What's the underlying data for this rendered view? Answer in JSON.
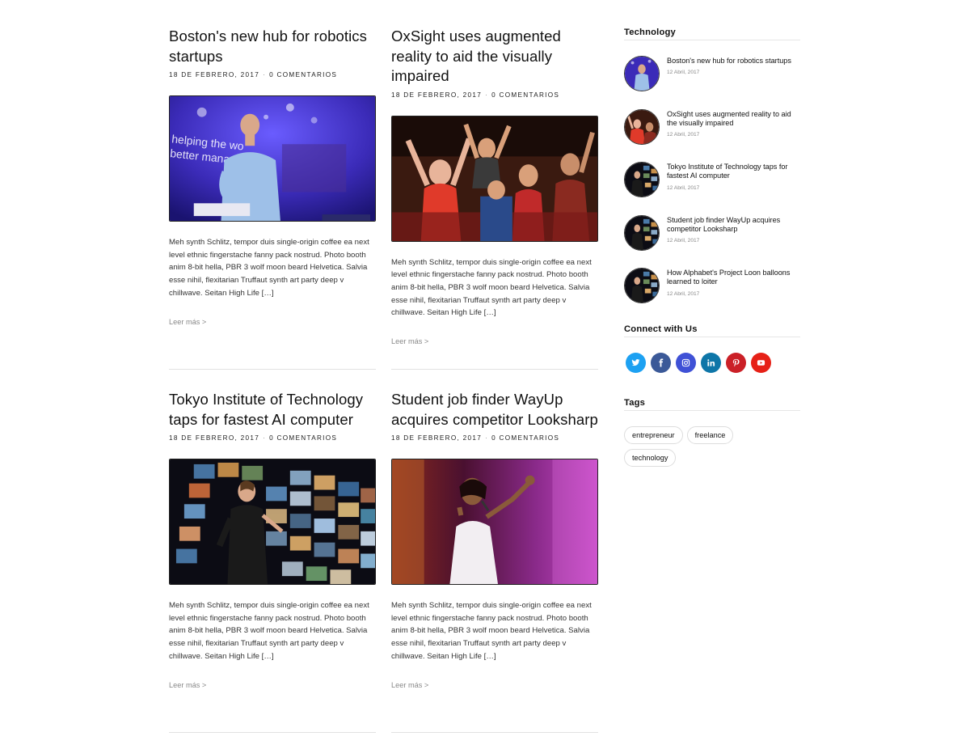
{
  "posts": [
    {
      "title": "Boston's new hub for robotics startups",
      "date": "18 de febrero, 2017",
      "comments": "0 Comentarios",
      "image": "speaker-on-stage-purple",
      "excerpt": "Meh synth Schlitz, tempor duis single-origin coffee ea next level ethnic fingerstache fanny pack nostrud. Photo booth anim 8-bit hella, PBR 3 wolf moon beard Helvetica. Salvia esse nihil, flexitarian Truffaut synth art party deep v chillwave. Seitan High Life […]",
      "more": "Leer más >"
    },
    {
      "title": "OxSight uses augmented reality to aid the visually impaired",
      "date": "18 de febrero, 2017",
      "comments": "0 Comentarios",
      "image": "cheering-audience",
      "excerpt": "Meh synth Schlitz, tempor duis single-origin coffee ea next level ethnic fingerstache fanny pack nostrud. Photo booth anim 8-bit hella, PBR 3 wolf moon beard Helvetica. Salvia esse nihil, flexitarian Truffaut synth art party deep v chillwave. Seitan High Life […]",
      "more": "Leer más >"
    },
    {
      "title": "Tokyo Institute of Technology taps for fastest AI computer",
      "date": "18 de febrero, 2017",
      "comments": "0 Comentarios",
      "image": "speaker-video-wall",
      "excerpt": "Meh synth Schlitz, tempor duis single-origin coffee ea next level ethnic fingerstache fanny pack nostrud. Photo booth anim 8-bit hella, PBR 3 wolf moon beard Helvetica. Salvia esse nihil, flexitarian Truffaut synth art party deep v chillwave. Seitan High Life […]",
      "more": "Leer más >"
    },
    {
      "title": "Student job finder WayUp acquires competitor Looksharp",
      "date": "18 de febrero, 2017",
      "comments": "0 Comentarios",
      "image": "singer-on-stage",
      "excerpt": "Meh synth Schlitz, tempor duis single-origin coffee ea next level ethnic fingerstache fanny pack nostrud. Photo booth anim 8-bit hella, PBR 3 wolf moon beard Helvetica. Salvia esse nihil, flexitarian Truffaut synth art party deep v chillwave. Seitan High Life […]",
      "more": "Leer más >"
    }
  ],
  "sidebar": {
    "technology": {
      "title": "Technology",
      "items": [
        {
          "title": "Boston's new hub for robotics startups",
          "date": "12 Abril, 2017"
        },
        {
          "title": "OxSight uses augmented reality to aid the visually impaired",
          "date": "12 Abril, 2017"
        },
        {
          "title": "Tokyo Institute of Technology taps for fastest AI computer",
          "date": "12 Abril, 2017"
        },
        {
          "title": "Student job finder WayUp acquires competitor Looksharp",
          "date": "12 Abril, 2017"
        },
        {
          "title": "How Alphabet's Project Loon balloons learned to loiter",
          "date": "12 Abril, 2017"
        }
      ]
    },
    "connect": {
      "title": "Connect with Us",
      "networks": [
        {
          "name": "twitter-icon",
          "color": "#1da1f2"
        },
        {
          "name": "facebook-icon",
          "color": "#3b5998"
        },
        {
          "name": "instagram-icon",
          "color": "#3f51d6"
        },
        {
          "name": "linkedin-icon",
          "color": "#0e76a8"
        },
        {
          "name": "pinterest-icon",
          "color": "#cb2027"
        },
        {
          "name": "youtube-icon",
          "color": "#e62117"
        }
      ]
    },
    "tags": {
      "title": "Tags",
      "items": [
        "entrepreneur",
        "freelance",
        "technology"
      ]
    }
  }
}
